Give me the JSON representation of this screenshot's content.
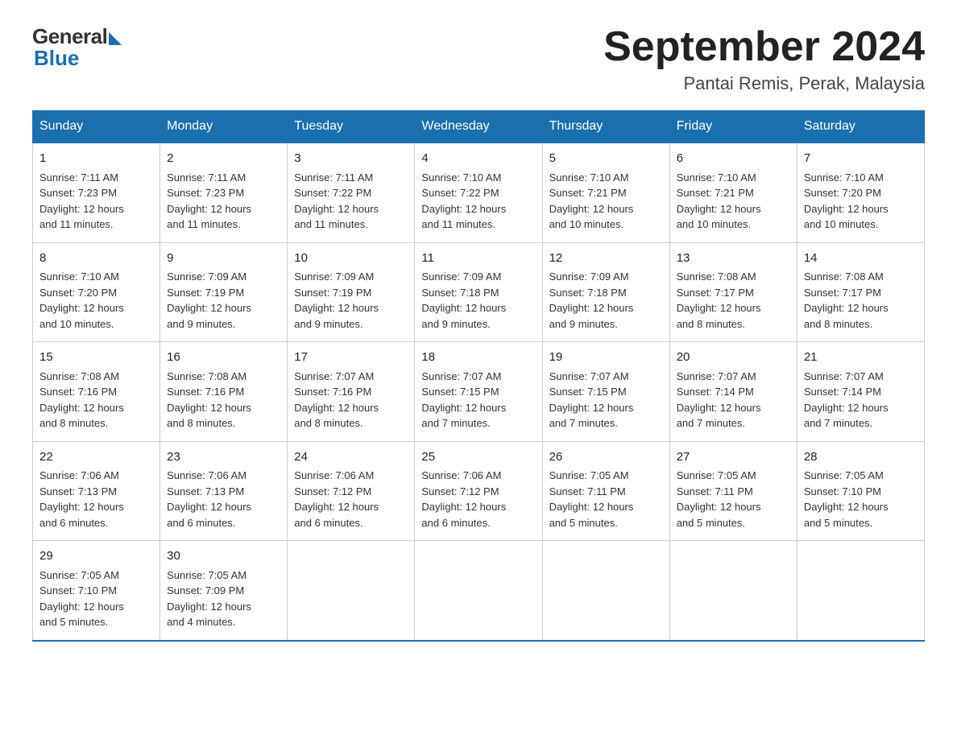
{
  "header": {
    "logo_general": "General",
    "logo_blue": "Blue",
    "month_title": "September 2024",
    "location": "Pantai Remis, Perak, Malaysia"
  },
  "weekdays": [
    "Sunday",
    "Monday",
    "Tuesday",
    "Wednesday",
    "Thursday",
    "Friday",
    "Saturday"
  ],
  "weeks": [
    [
      {
        "day": "1",
        "sunrise": "7:11 AM",
        "sunset": "7:23 PM",
        "daylight": "12 hours and 11 minutes."
      },
      {
        "day": "2",
        "sunrise": "7:11 AM",
        "sunset": "7:23 PM",
        "daylight": "12 hours and 11 minutes."
      },
      {
        "day": "3",
        "sunrise": "7:11 AM",
        "sunset": "7:22 PM",
        "daylight": "12 hours and 11 minutes."
      },
      {
        "day": "4",
        "sunrise": "7:10 AM",
        "sunset": "7:22 PM",
        "daylight": "12 hours and 11 minutes."
      },
      {
        "day": "5",
        "sunrise": "7:10 AM",
        "sunset": "7:21 PM",
        "daylight": "12 hours and 10 minutes."
      },
      {
        "day": "6",
        "sunrise": "7:10 AM",
        "sunset": "7:21 PM",
        "daylight": "12 hours and 10 minutes."
      },
      {
        "day": "7",
        "sunrise": "7:10 AM",
        "sunset": "7:20 PM",
        "daylight": "12 hours and 10 minutes."
      }
    ],
    [
      {
        "day": "8",
        "sunrise": "7:10 AM",
        "sunset": "7:20 PM",
        "daylight": "12 hours and 10 minutes."
      },
      {
        "day": "9",
        "sunrise": "7:09 AM",
        "sunset": "7:19 PM",
        "daylight": "12 hours and 9 minutes."
      },
      {
        "day": "10",
        "sunrise": "7:09 AM",
        "sunset": "7:19 PM",
        "daylight": "12 hours and 9 minutes."
      },
      {
        "day": "11",
        "sunrise": "7:09 AM",
        "sunset": "7:18 PM",
        "daylight": "12 hours and 9 minutes."
      },
      {
        "day": "12",
        "sunrise": "7:09 AM",
        "sunset": "7:18 PM",
        "daylight": "12 hours and 9 minutes."
      },
      {
        "day": "13",
        "sunrise": "7:08 AM",
        "sunset": "7:17 PM",
        "daylight": "12 hours and 8 minutes."
      },
      {
        "day": "14",
        "sunrise": "7:08 AM",
        "sunset": "7:17 PM",
        "daylight": "12 hours and 8 minutes."
      }
    ],
    [
      {
        "day": "15",
        "sunrise": "7:08 AM",
        "sunset": "7:16 PM",
        "daylight": "12 hours and 8 minutes."
      },
      {
        "day": "16",
        "sunrise": "7:08 AM",
        "sunset": "7:16 PM",
        "daylight": "12 hours and 8 minutes."
      },
      {
        "day": "17",
        "sunrise": "7:07 AM",
        "sunset": "7:16 PM",
        "daylight": "12 hours and 8 minutes."
      },
      {
        "day": "18",
        "sunrise": "7:07 AM",
        "sunset": "7:15 PM",
        "daylight": "12 hours and 7 minutes."
      },
      {
        "day": "19",
        "sunrise": "7:07 AM",
        "sunset": "7:15 PM",
        "daylight": "12 hours and 7 minutes."
      },
      {
        "day": "20",
        "sunrise": "7:07 AM",
        "sunset": "7:14 PM",
        "daylight": "12 hours and 7 minutes."
      },
      {
        "day": "21",
        "sunrise": "7:07 AM",
        "sunset": "7:14 PM",
        "daylight": "12 hours and 7 minutes."
      }
    ],
    [
      {
        "day": "22",
        "sunrise": "7:06 AM",
        "sunset": "7:13 PM",
        "daylight": "12 hours and 6 minutes."
      },
      {
        "day": "23",
        "sunrise": "7:06 AM",
        "sunset": "7:13 PM",
        "daylight": "12 hours and 6 minutes."
      },
      {
        "day": "24",
        "sunrise": "7:06 AM",
        "sunset": "7:12 PM",
        "daylight": "12 hours and 6 minutes."
      },
      {
        "day": "25",
        "sunrise": "7:06 AM",
        "sunset": "7:12 PM",
        "daylight": "12 hours and 6 minutes."
      },
      {
        "day": "26",
        "sunrise": "7:05 AM",
        "sunset": "7:11 PM",
        "daylight": "12 hours and 5 minutes."
      },
      {
        "day": "27",
        "sunrise": "7:05 AM",
        "sunset": "7:11 PM",
        "daylight": "12 hours and 5 minutes."
      },
      {
        "day": "28",
        "sunrise": "7:05 AM",
        "sunset": "7:10 PM",
        "daylight": "12 hours and 5 minutes."
      }
    ],
    [
      {
        "day": "29",
        "sunrise": "7:05 AM",
        "sunset": "7:10 PM",
        "daylight": "12 hours and 5 minutes."
      },
      {
        "day": "30",
        "sunrise": "7:05 AM",
        "sunset": "7:09 PM",
        "daylight": "12 hours and 4 minutes."
      },
      null,
      null,
      null,
      null,
      null
    ]
  ],
  "labels": {
    "sunrise": "Sunrise:",
    "sunset": "Sunset:",
    "daylight": "Daylight:"
  }
}
